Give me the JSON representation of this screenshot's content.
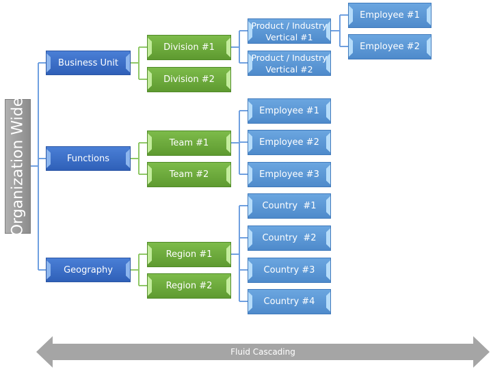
{
  "root": {
    "label": "Organization Wide"
  },
  "level1": [
    "Business Unit",
    "Functions",
    "Geography"
  ],
  "business_unit": {
    "divisions": [
      "Division #1",
      "Division #2"
    ],
    "verticals": [
      "Product  / Industry Vertical #1",
      "Product  / Industry Vertical #2"
    ],
    "employees": [
      "Employee #1",
      "Employee #2"
    ]
  },
  "functions": {
    "teams": [
      "Team #1",
      "Team #2"
    ],
    "employees": [
      "Employee #1",
      "Employee #2",
      "Employee #3"
    ]
  },
  "geography": {
    "regions": [
      "Region #1",
      "Region #2"
    ],
    "countries": [
      "Country  #1",
      "Country  #2",
      "Country #3",
      "Country #4"
    ]
  },
  "arrow": {
    "label": "Fluid Cascading"
  },
  "colors": {
    "level1": "#3a6bc4",
    "level2": "#6eaa3d",
    "level3": "#5b9bd5",
    "root": "#a0a0a0",
    "arrow": "#a5a5a5"
  }
}
